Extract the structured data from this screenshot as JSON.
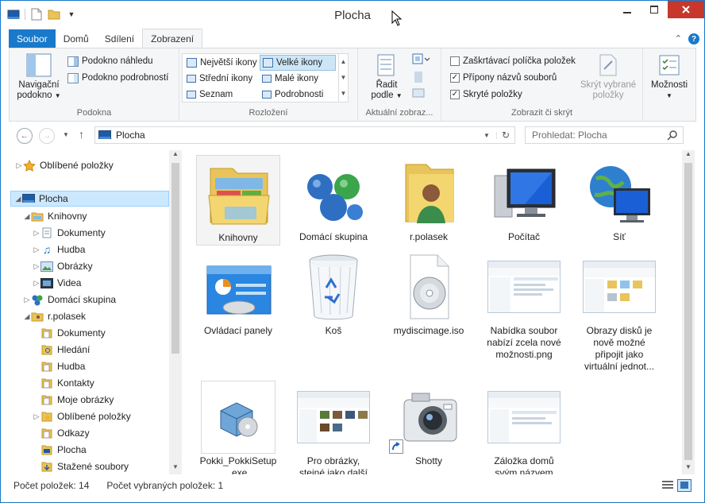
{
  "window": {
    "title": "Plocha"
  },
  "ribbon_tabs": [
    "Soubor",
    "Domů",
    "Sdílení",
    "Zobrazení"
  ],
  "ribbon": {
    "podokna": {
      "navigacni_label_1": "Navigační",
      "navigacni_label_2": "podokno",
      "nahled": "Podokno náhledu",
      "podrobnosti": "Podokno podrobností",
      "group": "Podokna"
    },
    "rozlozeni": {
      "items": [
        "Největší ikony",
        "Velké ikony",
        "Střední ikony",
        "Malé ikony",
        "Seznam",
        "Podrobnosti"
      ],
      "group": "Rozložení"
    },
    "aktualni": {
      "radit_1": "Řadit",
      "radit_2": "podle",
      "group": "Aktuální zobraz..."
    },
    "zobrazit": {
      "checkbox1": "Zaškrtávací políčka položek",
      "checkbox2": "Přípony názvů souborů",
      "checkbox3": "Skryté položky",
      "skryt_1": "Skrýt vybrané",
      "skryt_2": "položky",
      "group": "Zobrazit či skrýt"
    },
    "moznosti": {
      "label": "Možnosti"
    }
  },
  "address": {
    "path": "Plocha",
    "search_placeholder": "Prohledat: Plocha"
  },
  "tree": [
    {
      "label": "Oblíbené položky",
      "level": 0
    },
    {
      "label": "Plocha",
      "level": 0
    },
    {
      "label": "Knihovny",
      "level": 1
    },
    {
      "label": "Dokumenty",
      "level": 2
    },
    {
      "label": "Hudba",
      "level": 2
    },
    {
      "label": "Obrázky",
      "level": 2
    },
    {
      "label": "Videa",
      "level": 2
    },
    {
      "label": "Domácí skupina",
      "level": 1
    },
    {
      "label": "r.polasek",
      "level": 1
    },
    {
      "label": "Dokumenty",
      "level": 2
    },
    {
      "label": "Hledání",
      "level": 2
    },
    {
      "label": "Hudba",
      "level": 2
    },
    {
      "label": "Kontakty",
      "level": 2
    },
    {
      "label": "Moje obrázky",
      "level": 2
    },
    {
      "label": "Oblíbené položky",
      "level": 2
    },
    {
      "label": "Odkazy",
      "level": 2
    },
    {
      "label": "Plocha",
      "level": 2
    },
    {
      "label": "Stažené soubory",
      "level": 2
    }
  ],
  "items": [
    {
      "l1": "Knihovny"
    },
    {
      "l1": "Domácí skupina"
    },
    {
      "l1": "r.polasek"
    },
    {
      "l1": "Počítač"
    },
    {
      "l1": "Síť"
    },
    {
      "l1": "Ovládací panely"
    },
    {
      "l1": "Koš"
    },
    {
      "l1": "mydiscimage.iso"
    },
    {
      "l1": "Nabídka soubor",
      "l2": "nabízí zcela nové",
      "l3": "možnosti.png"
    },
    {
      "l1": "Obrazy disků je",
      "l2": "nově možné",
      "l3": "připojit jako",
      "l4": "virtuální jednot..."
    },
    {
      "l1": "Pokki_PokkiSetup",
      "l2": ".exe"
    },
    {
      "l1": "Pro obrázky,",
      "l2": "stejné jako další"
    },
    {
      "l1": "Shotty"
    },
    {
      "l1": "Záložka domů",
      "l2": "svým názvem"
    }
  ],
  "status": {
    "count": "Počet položek: 14",
    "selected": "Počet vybraných položek: 1"
  },
  "colors": {
    "accent": "#1979ca",
    "close": "#c7372c",
    "selection": "#cce8ff"
  }
}
